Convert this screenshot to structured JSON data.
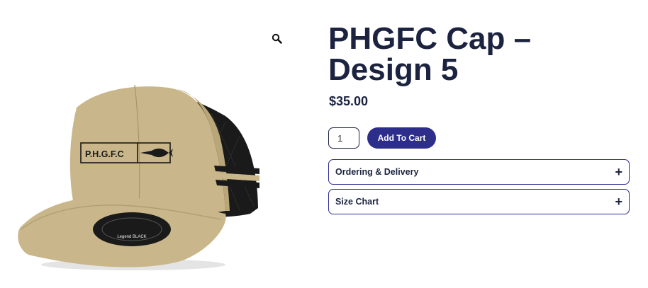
{
  "product": {
    "title": "PHGFC Cap – Design 5",
    "price": "$35.00",
    "quantity": "1",
    "add_to_cart_label": "Add To Cart",
    "image": {
      "logo_text": "P.H.G.F.C",
      "badge_text": "Legend BLACK"
    }
  },
  "accordion": [
    {
      "label": "Ordering & Delivery",
      "icon": "plus-icon"
    },
    {
      "label": "Size Chart",
      "icon": "plus-icon"
    }
  ],
  "gallery": {
    "zoom_icon": "magnifier-icon"
  },
  "colors": {
    "heading": "#1c2340",
    "button": "#2d2d8c",
    "cap_tan": "#c9b68a",
    "mesh_black": "#1a1a1a"
  }
}
